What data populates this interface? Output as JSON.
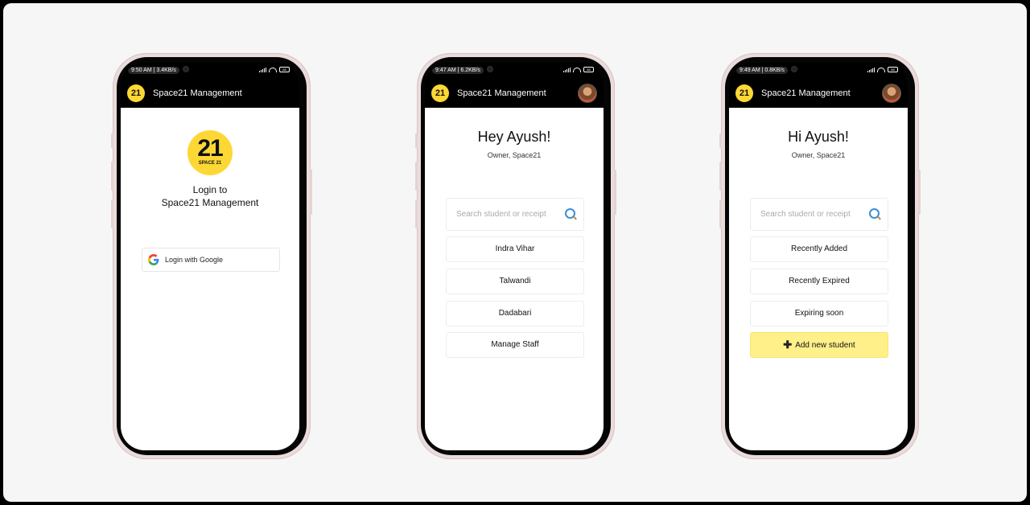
{
  "phones": [
    {
      "status_time": "9:50 AM | 3.4KB/s",
      "app_title": "Space21 Management",
      "logo_num": "21",
      "logo_sub": "SPACE 21",
      "login_line1": "Login to",
      "login_line2": "Space21 Management",
      "google_button": "Login with Google",
      "battery": "88"
    },
    {
      "status_time": "9:47 AM | 6.2KB/s",
      "app_title": "Space21 Management",
      "greeting": "Hey Ayush!",
      "role": "Owner, Space21",
      "search_placeholder": "Search student or receipt",
      "buttons": [
        "Indra Vihar",
        "Talwandi",
        "Dadabari",
        "Manage Staff"
      ],
      "battery": "88"
    },
    {
      "status_time": "9:49 AM | 0.8KB/s",
      "app_title": "Space21 Management",
      "greeting": "Hi Ayush!",
      "role": "Owner, Space21",
      "search_placeholder": "Search student or receipt",
      "buttons": [
        "Recently Added",
        "Recently Expired",
        "Expiring soon"
      ],
      "add_button": "Add new student",
      "battery": "88"
    }
  ],
  "icons": {
    "logo": "space21-logo-icon",
    "avatar": "user-avatar-icon",
    "search": "magnifier-icon",
    "google": "google-g-icon",
    "plus": "plus-icon"
  },
  "colors": {
    "brand_yellow": "#fdd835",
    "add_button_bg": "#fff08a",
    "appbar_bg": "#000000"
  }
}
